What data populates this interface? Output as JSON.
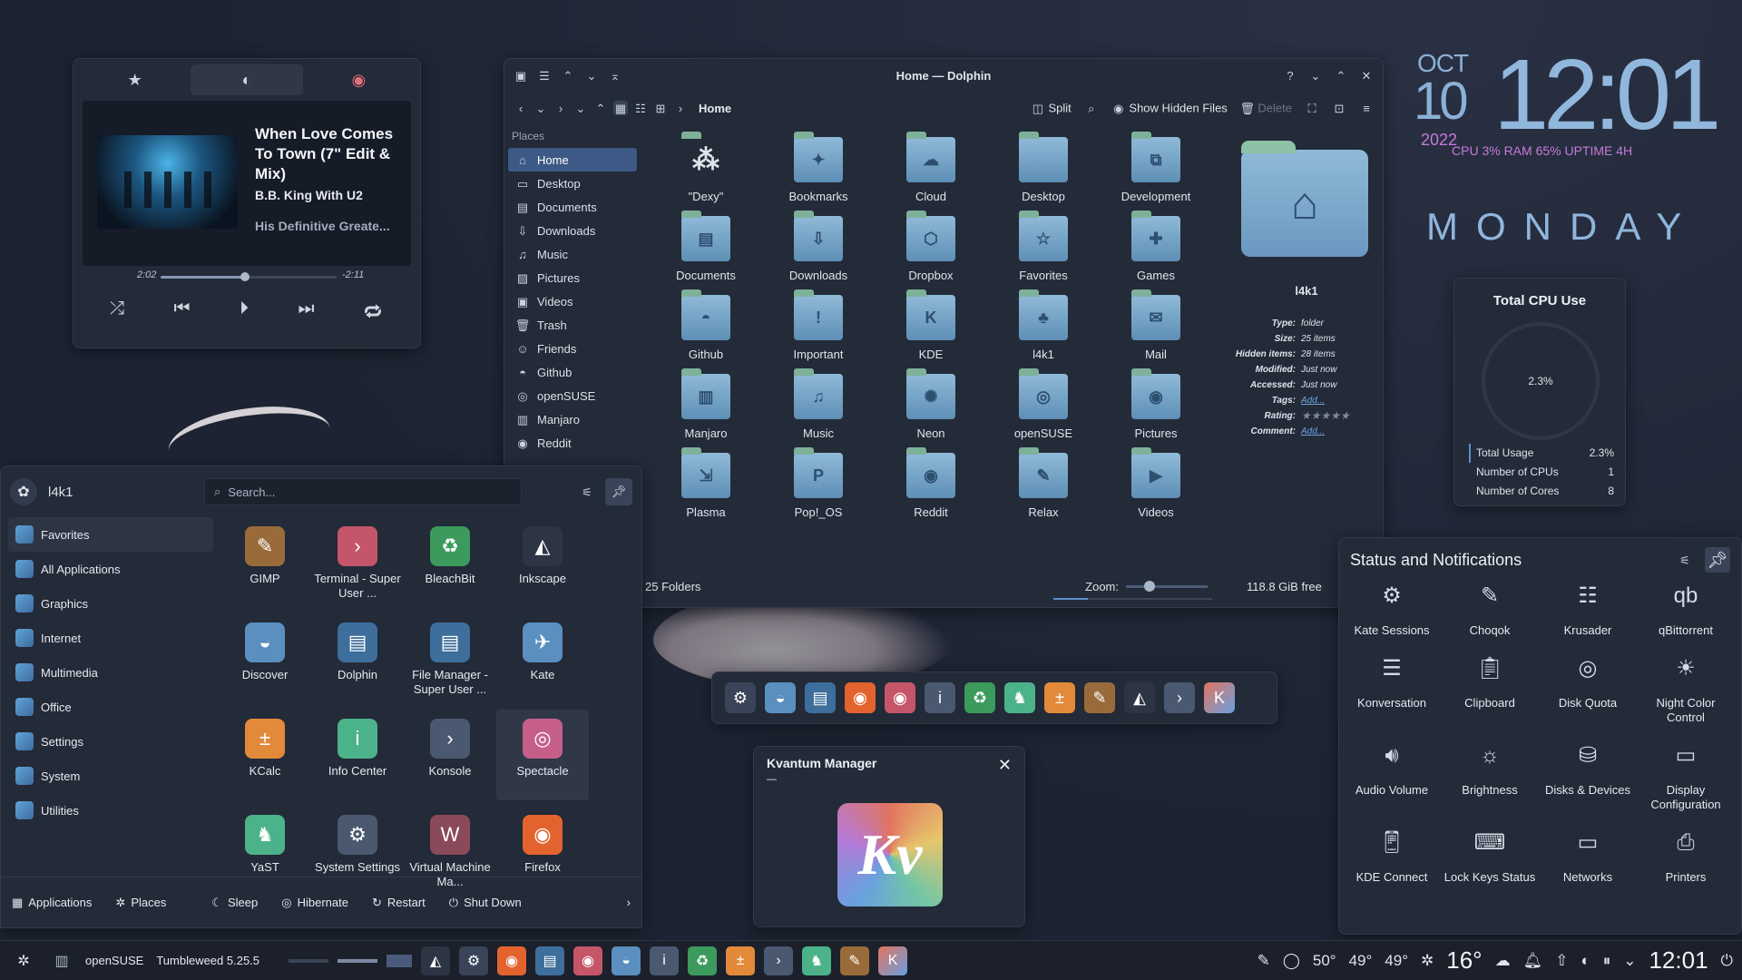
{
  "player": {
    "song": "When Love Comes To Town (7\" Edit & Mix)",
    "artist": "B.B. King With U2",
    "album": "His Definitive Greate...",
    "elapsed": "2:02",
    "remaining": "-2:11",
    "progress": 0.48
  },
  "dolphin": {
    "title": "Home — Dolphin",
    "crumb": "Home",
    "split": "Split",
    "show_hidden": "Show Hidden Files",
    "delete": "Delete",
    "places_header": "Places",
    "places": [
      "Home",
      "Desktop",
      "Documents",
      "Downloads",
      "Music",
      "Pictures",
      "Videos",
      "Trash",
      "Friends",
      "Github",
      "openSUSE",
      "Manjaro",
      "Reddit"
    ],
    "folders": [
      "\"Dexy\"",
      "Bookmarks",
      "Cloud",
      "Desktop",
      "Development",
      "Documents",
      "Downloads",
      "Dropbox",
      "Favorites",
      "Games",
      "Github",
      "Important",
      "KDE",
      "l4k1",
      "Mail",
      "Manjaro",
      "Music",
      "Neon",
      "openSUSE",
      "Pictures",
      "Plasma",
      "Pop!_OS",
      "Reddit",
      "Relax",
      "Videos"
    ],
    "count": "25 Folders",
    "zoom_label": "Zoom:",
    "free": "118.8 GiB free",
    "info": {
      "name": "l4k1",
      "type_k": "Type:",
      "type_v": "folder",
      "size_k": "Size:",
      "size_v": "25 items",
      "hidden_k": "Hidden items:",
      "hidden_v": "28 items",
      "mod_k": "Modified:",
      "mod_v": "Just now",
      "acc_k": "Accessed:",
      "acc_v": "Just now",
      "tags_k": "Tags:",
      "tags_v": "Add...",
      "rating_k": "Rating:",
      "rating_v": "★★★★★",
      "comment_k": "Comment:",
      "comment_v": "Add..."
    }
  },
  "clock": {
    "month": "OCT",
    "day": "10",
    "time": "12:01",
    "year": "2022",
    "stats": "CPU 3% RAM 65% UPTIME 4H",
    "weekday": "MONDAY"
  },
  "cpu": {
    "title": "Total CPU Use",
    "value": "2.3%",
    "rows": [
      {
        "k": "Total Usage",
        "v": "2.3%"
      },
      {
        "k": "Number of CPUs",
        "v": "1"
      },
      {
        "k": "Number of Cores",
        "v": "8"
      }
    ]
  },
  "notif": {
    "title": "Status and Notifications",
    "items": [
      "Kate Sessions",
      "Choqok",
      "Krusader",
      "qBittorrent",
      "Konversation",
      "Clipboard",
      "Disk Quota",
      "Night Color Control",
      "Audio Volume",
      "Brightness",
      "Disks & Devices",
      "Display Configuration",
      "KDE Connect",
      "Lock Keys Status",
      "Networks",
      "Printers"
    ]
  },
  "launcher": {
    "user": "l4k1",
    "search_placeholder": "Search...",
    "categories": [
      "Favorites",
      "All Applications",
      "Graphics",
      "Internet",
      "Multimedia",
      "Office",
      "Settings",
      "System",
      "Utilities"
    ],
    "apps": [
      "GIMP",
      "Terminal - Super User ...",
      "BleachBit",
      "Inkscape",
      "Discover",
      "Dolphin",
      "File Manager - Super User ...",
      "Kate",
      "KCalc",
      "Info Center",
      "Konsole",
      "Spectacle",
      "YaST",
      "System Settings",
      "Virtual Machine Ma...",
      "Firefox"
    ],
    "footer": {
      "applications": "Applications",
      "places": "Places",
      "sleep": "Sleep",
      "hibernate": "Hibernate",
      "restart": "Restart",
      "shutdown": "Shut Down"
    }
  },
  "kvantum": {
    "title": "Kvantum Manager",
    "sub": "—"
  },
  "taskbar": {
    "distro": "openSUSE",
    "version": "Tumbleweed 5.25.5",
    "t1": "50°",
    "t2": "49°",
    "t3": "49°",
    "weather": "16°",
    "clock": "12:01"
  }
}
